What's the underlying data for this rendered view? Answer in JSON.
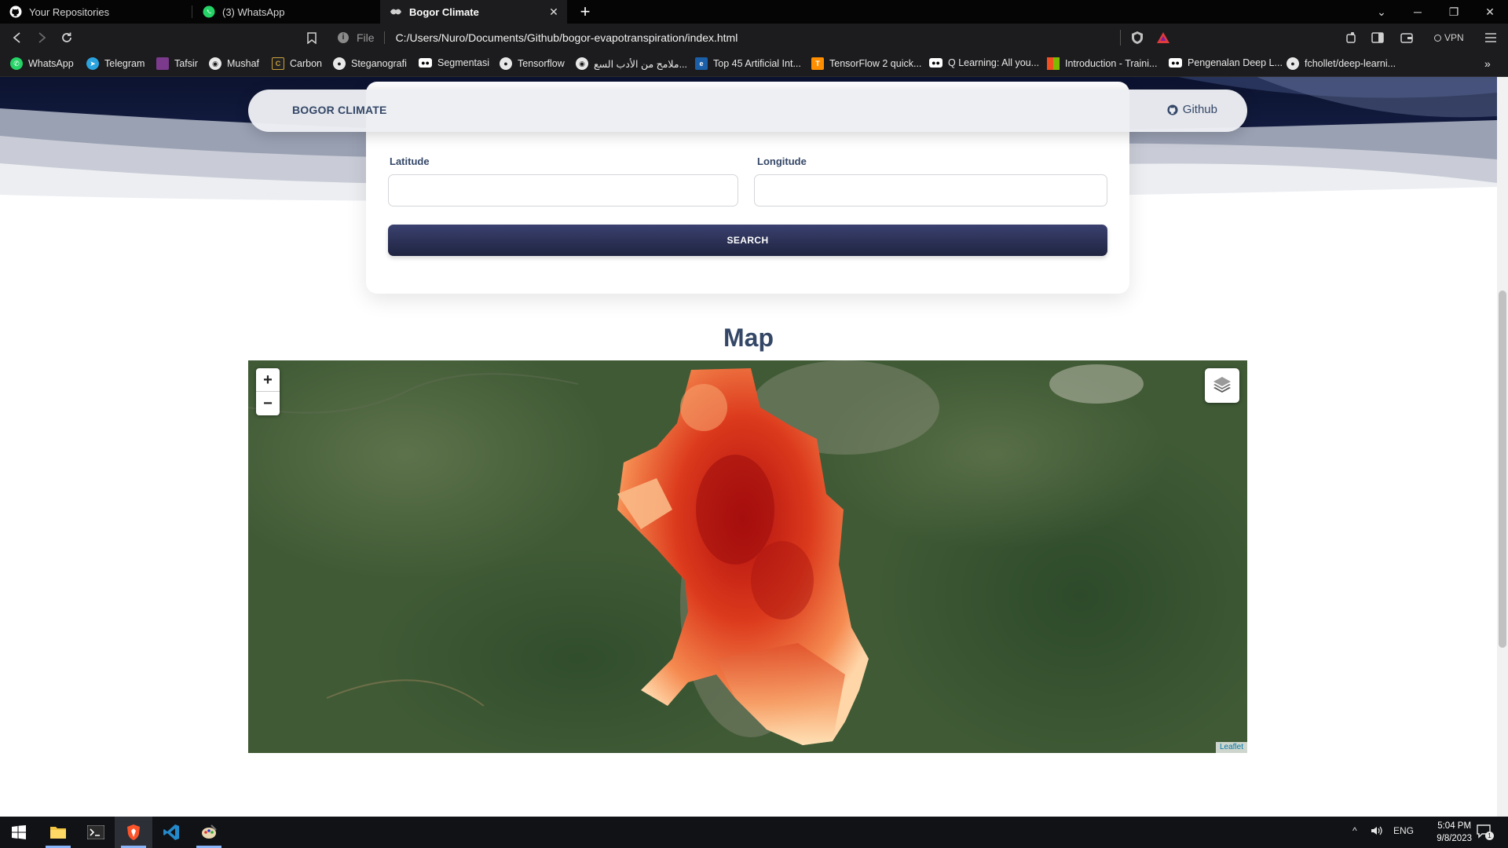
{
  "browser": {
    "tabs": [
      {
        "label": "Your Repositories",
        "icon": "github-icon"
      },
      {
        "label": "(3) WhatsApp",
        "icon": "whatsapp-icon"
      },
      {
        "label": "Bogor Climate",
        "icon": "site-icon",
        "active": true
      }
    ],
    "url_scheme": "File",
    "url": "C:/Users/Nuro/Documents/Github/bogor-evapotranspiration/index.html",
    "vpn_label": "VPN",
    "bookmarks": [
      "WhatsApp",
      "Telegram",
      "Tafsir",
      "Mushaf",
      "Carbon",
      "Steganografi",
      "Segmentasi",
      "Tensorflow",
      "ملامح من الأدب السع...",
      "Top 45 Artificial Int...",
      "TensorFlow 2 quick...",
      "Q Learning: All you...",
      "Introduction - Traini...",
      "Pengenalan Deep L...",
      "fchollet/deep-learni..."
    ]
  },
  "page": {
    "brand": "BOGOR CLIMATE",
    "github_link": "Github",
    "form": {
      "latitude_label": "Latitude",
      "latitude_value": "",
      "longitude_label": "Longitude",
      "longitude_value": "",
      "search_button": "SEARCH"
    },
    "map_heading": "Map",
    "map": {
      "zoom_in": "+",
      "zoom_out": "−",
      "attribution": "Leaflet",
      "layer": "evapotranspiration heatmap over satellite imagery"
    }
  },
  "taskbar": {
    "apps": [
      "windows-start-icon",
      "file-explorer-icon",
      "terminal-icon",
      "brave-icon",
      "vscode-icon",
      "paint-icon"
    ],
    "language": "ENG",
    "time": "5:04 PM",
    "date": "9/8/2023",
    "notification_count": "1"
  },
  "colors": {
    "accent": "#344767",
    "button": "#252a4a",
    "heat_low": "#ffe3b8",
    "heat_high": "#b10f0f",
    "vegetation": "#3f5a35"
  }
}
